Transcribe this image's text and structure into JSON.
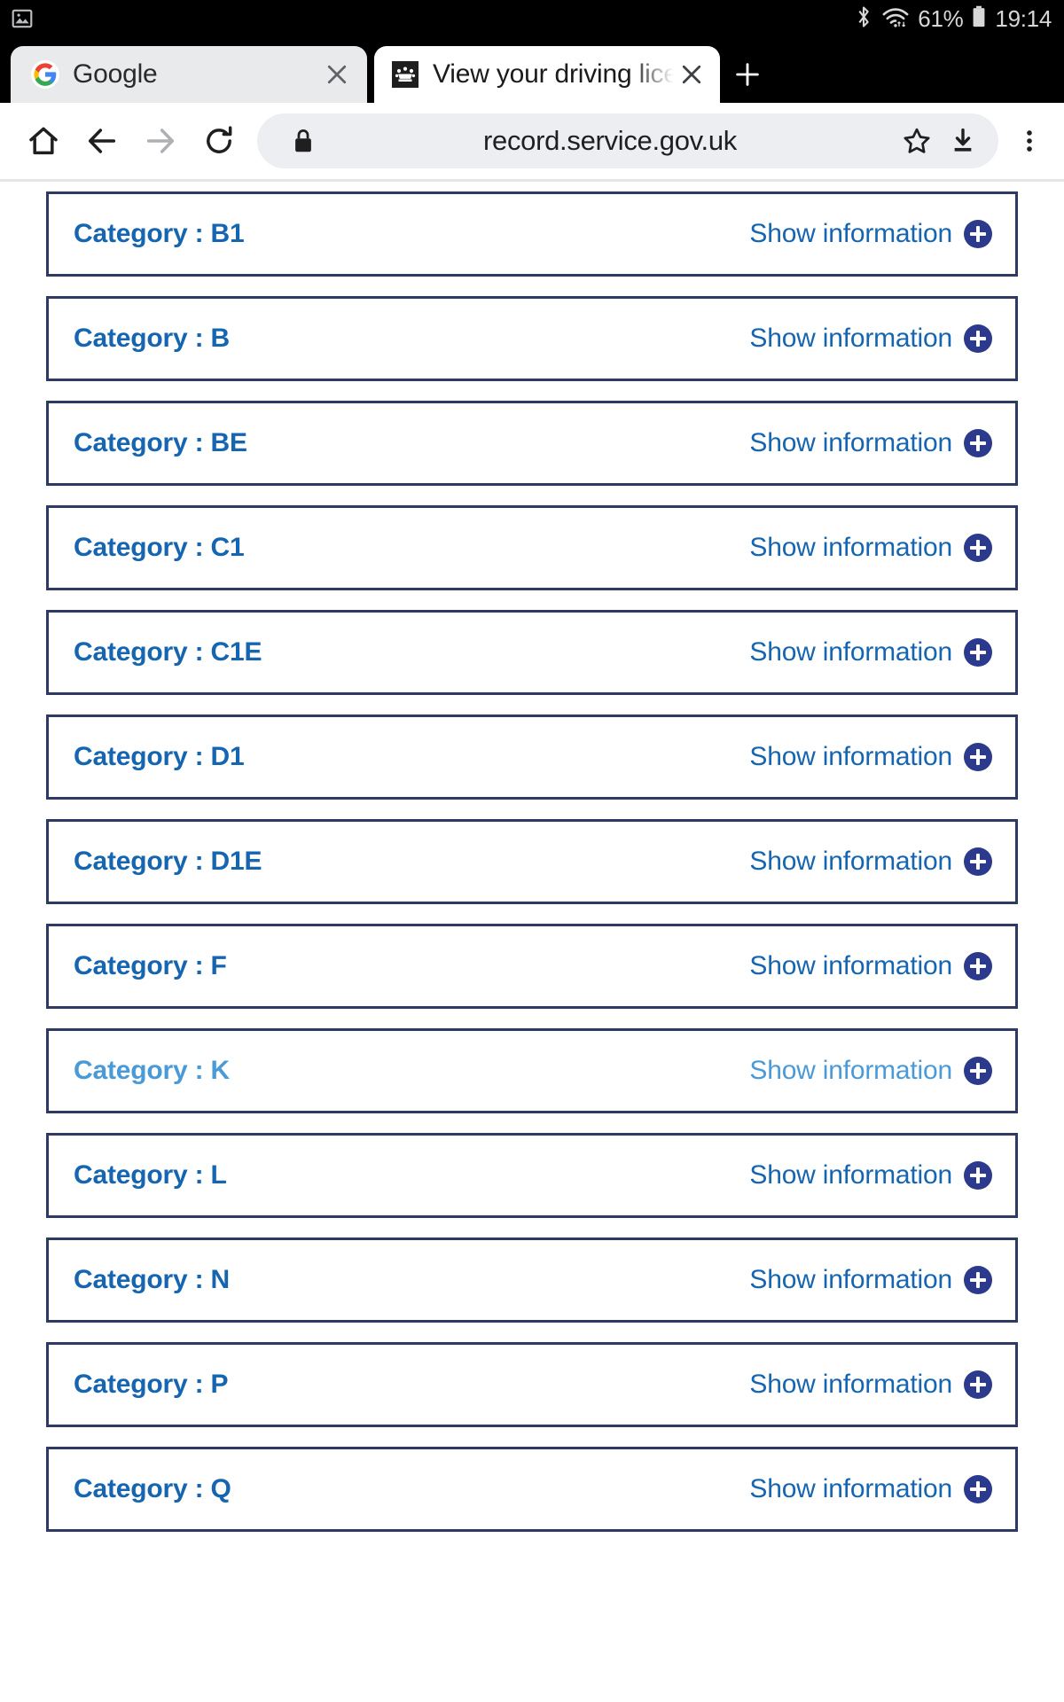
{
  "status_bar": {
    "left_icon": "gallery-icon",
    "icons": [
      "bluetooth-icon",
      "wifi-icon"
    ],
    "battery_percent": "61%",
    "battery_icon": "battery-icon",
    "clock": "19:14"
  },
  "tabs": [
    {
      "title": "Google",
      "favicon": "google-g-icon",
      "active": false,
      "close_label": "×"
    },
    {
      "title": "View your driving licen",
      "favicon": "govuk-crown-icon",
      "active": true,
      "close_label": "×"
    }
  ],
  "new_tab_label": "+",
  "toolbar": {
    "home_icon": "home-icon",
    "back_icon": "back-arrow-icon",
    "forward_icon": "forward-arrow-icon",
    "reload_icon": "reload-icon",
    "lock_icon": "lock-icon",
    "url": "record.service.gov.uk",
    "bookmark_icon": "star-icon",
    "download_icon": "download-icon",
    "menu_icon": "overflow-menu-icon"
  },
  "accordion": {
    "show_information_label": "Show information",
    "items": [
      {
        "title": "Category : B1",
        "muted": false
      },
      {
        "title": "Category : B",
        "muted": false
      },
      {
        "title": "Category : BE",
        "muted": false
      },
      {
        "title": "Category : C1",
        "muted": false
      },
      {
        "title": "Category : C1E",
        "muted": false
      },
      {
        "title": "Category : D1",
        "muted": false
      },
      {
        "title": "Category : D1E",
        "muted": false
      },
      {
        "title": "Category : F",
        "muted": false
      },
      {
        "title": "Category : K",
        "muted": true
      },
      {
        "title": "Category : L",
        "muted": false
      },
      {
        "title": "Category : N",
        "muted": false
      },
      {
        "title": "Category : P",
        "muted": false
      },
      {
        "title": "Category : Q",
        "muted": false
      }
    ]
  },
  "colors": {
    "govuk_link_blue": "#1565b0",
    "govuk_link_blue_muted": "#4b9ad8",
    "card_border_navy": "#2e3a63",
    "plus_badge_navy": "#2b3a8c"
  }
}
